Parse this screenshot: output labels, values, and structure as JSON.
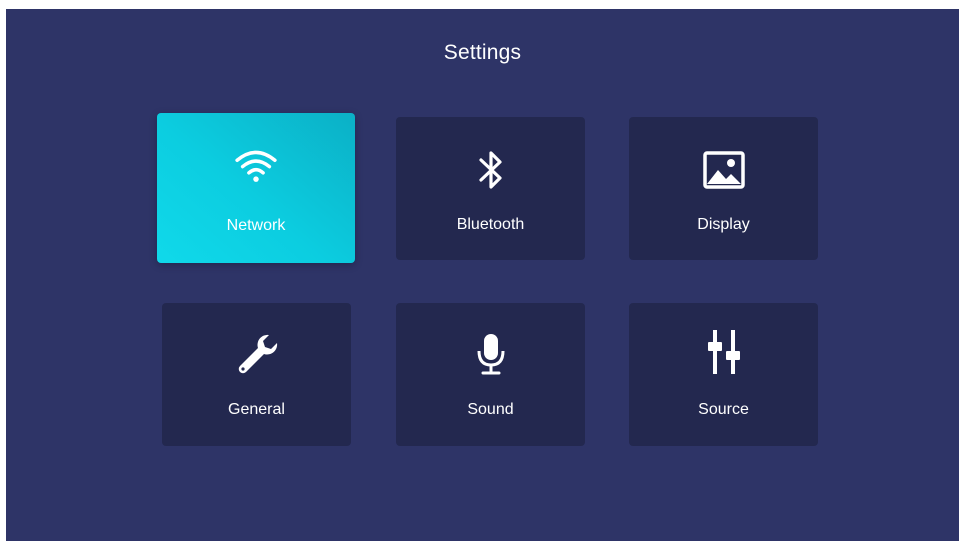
{
  "header": {
    "title": "Settings"
  },
  "tiles": [
    {
      "label": "Network",
      "icon": "wifi-icon",
      "selected": true
    },
    {
      "label": "Bluetooth",
      "icon": "bluetooth-icon",
      "selected": false
    },
    {
      "label": "Display",
      "icon": "image-icon",
      "selected": false
    },
    {
      "label": "General",
      "icon": "wrench-icon",
      "selected": false
    },
    {
      "label": "Sound",
      "icon": "microphone-icon",
      "selected": false
    },
    {
      "label": "Source",
      "icon": "sliders-icon",
      "selected": false
    }
  ],
  "colors": {
    "background": "#2e3467",
    "tile": "#23284f",
    "selected_tile": "#0ccde0",
    "text": "#ffffff"
  }
}
